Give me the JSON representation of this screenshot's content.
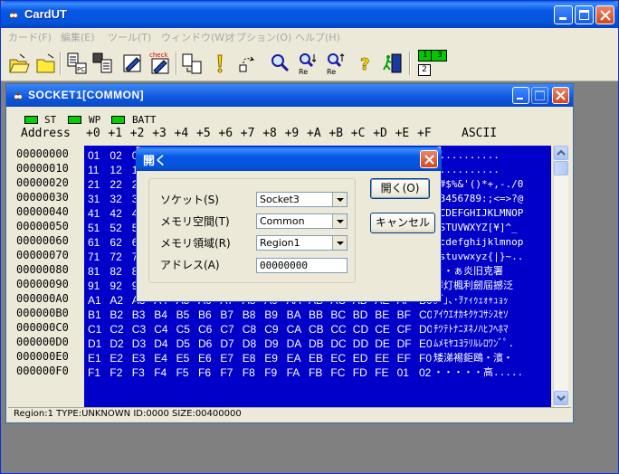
{
  "app": {
    "title": "CardUT"
  },
  "menu": [
    {
      "label": "カード(F)"
    },
    {
      "label": "編集(E)"
    },
    {
      "label": "ツール(T)"
    },
    {
      "label": "ウィンドウ(W)"
    },
    {
      "label": "オプション(O)"
    },
    {
      "label": "ヘルプ(H)"
    }
  ],
  "toolbar": {
    "check_label": "check",
    "re_label": "Re",
    "pc_label": "PC",
    "indicator_top": [
      "1",
      "3"
    ],
    "indicator_bottom": "2"
  },
  "child": {
    "title": "SOCKET1[COMMON]",
    "leds": [
      {
        "label": "ST"
      },
      {
        "label": "WP"
      },
      {
        "label": "BATT"
      }
    ],
    "header": {
      "address": "Address",
      "columns": [
        "+0",
        "+1",
        "+2",
        "+3",
        "+4",
        "+5",
        "+6",
        "+7",
        "+8",
        "+9",
        "+A",
        "+B",
        "+C",
        "+D",
        "+E",
        "+F"
      ],
      "ascii": "ASCII"
    },
    "addresses": [
      "00000000",
      "00000010",
      "00000020",
      "00000030",
      "00000040",
      "00000050",
      "00000060",
      "00000070",
      "00000080",
      "00000090",
      "000000A0",
      "000000B0",
      "000000C0",
      "000000D0",
      "000000E0",
      "000000F0"
    ],
    "hex_rows": [
      [
        "01",
        "02",
        "0",
        "",
        "",
        "",
        "",
        "",
        "",
        "",
        "",
        "",
        "",
        "",
        "",
        ""
      ],
      [
        "11",
        "12",
        "1",
        "",
        "",
        "",
        "",
        "",
        "",
        "",
        "",
        "",
        "",
        "",
        "",
        ""
      ],
      [
        "21",
        "22",
        "2",
        "",
        "",
        "",
        "",
        "",
        "",
        "",
        "",
        "",
        "",
        "",
        "",
        ""
      ],
      [
        "31",
        "32",
        "3",
        "",
        "",
        "",
        "",
        "",
        "",
        "",
        "",
        "",
        "",
        "",
        "",
        ""
      ],
      [
        "41",
        "42",
        "4",
        "",
        "",
        "",
        "",
        "",
        "",
        "",
        "",
        "",
        "",
        "",
        "",
        ""
      ],
      [
        "51",
        "52",
        "5",
        "",
        "",
        "",
        "",
        "",
        "",
        "",
        "",
        "",
        "",
        "",
        "",
        ""
      ],
      [
        "61",
        "62",
        "6",
        "",
        "",
        "",
        "",
        "",
        "",
        "",
        "",
        "",
        "",
        "",
        "",
        ""
      ],
      [
        "71",
        "72",
        "7",
        "",
        "",
        "",
        "",
        "",
        "",
        "",
        "",
        "",
        "",
        "",
        "",
        ""
      ],
      [
        "81",
        "82",
        "8",
        "",
        "",
        "",
        "",
        "",
        "",
        "",
        "",
        "",
        "",
        "",
        "",
        ""
      ],
      [
        "91",
        "92",
        "9",
        "",
        "",
        "",
        "",
        "",
        "",
        "",
        "",
        "",
        "",
        "",
        "",
        ""
      ],
      [
        "A1",
        "A2",
        "A3",
        "A4",
        "A5",
        "A6",
        "A7",
        "A8",
        "A9",
        "AA",
        "AB",
        "AC",
        "AD",
        "AE",
        "AF",
        "B0"
      ],
      [
        "B1",
        "B2",
        "B3",
        "B4",
        "B5",
        "B6",
        "B7",
        "B8",
        "B9",
        "BA",
        "BB",
        "BC",
        "BD",
        "BE",
        "BF",
        "C0"
      ],
      [
        "C1",
        "C2",
        "C3",
        "C4",
        "C5",
        "C6",
        "C7",
        "C8",
        "C9",
        "CA",
        "CB",
        "CC",
        "CD",
        "CE",
        "CF",
        "D0"
      ],
      [
        "D1",
        "D2",
        "D3",
        "D4",
        "D5",
        "D6",
        "D7",
        "D8",
        "D9",
        "DA",
        "DB",
        "DC",
        "DD",
        "DE",
        "DF",
        "E0"
      ],
      [
        "E1",
        "E2",
        "E3",
        "E4",
        "E5",
        "E6",
        "E7",
        "E8",
        "E9",
        "EA",
        "EB",
        "EC",
        "ED",
        "EE",
        "EF",
        "F0"
      ],
      [
        "F1",
        "F2",
        "F3",
        "F4",
        "F5",
        "F6",
        "F7",
        "F8",
        "F9",
        "FA",
        "FB",
        "FC",
        "FD",
        "FE",
        "01",
        "02"
      ]
    ],
    "ascii_rows": [
      "...........",
      "...........",
      "\"#$%&'()*+,-./0",
      "23456789:;<=>?@",
      "BCDEFGHIJKLMNOP",
      "RSTUVWXYZ[¥]^_",
      "bcdefghijklmnop",
      "rstuvwxyz{|}~..",
      "ャ・ぁ炎旧克署",
      "葬灯楓利劒屆撼泛",
      "｡｢｣､･ｦｧｨｩｪｫｬｭｮｯ",
      "ｱｲｳｴｵｶｷｸｹｺｻｼｽｾｿ",
      "ﾁﾂﾃﾄﾅﾆﾇﾈﾉﾊﾋﾌﾍﾎﾏ",
      "ﾑﾒﾓﾔﾕﾖﾗﾘﾙﾚﾛﾜﾝﾞﾟ.",
      "矮涕裼鉅鴎・濱・",
      "・・・・・高....."
    ],
    "status": "Region:1 TYPE:UNKNOWN ID:0000 SIZE:00400000"
  },
  "dialog": {
    "title": "開く",
    "fields": [
      {
        "label": "ソケット(S)",
        "value": "Socket3"
      },
      {
        "label": "メモリ空間(T)",
        "value": "Common"
      },
      {
        "label": "メモリ領域(R)",
        "value": "Region1"
      },
      {
        "label": "アドレス(A)",
        "value": "00000000"
      }
    ],
    "open_button": "開く(O)",
    "cancel_button": "キャンセル"
  },
  "colors": {
    "hex_background": "#0000C8",
    "led_green": "#00D000",
    "title_blue": "#0758E6"
  }
}
